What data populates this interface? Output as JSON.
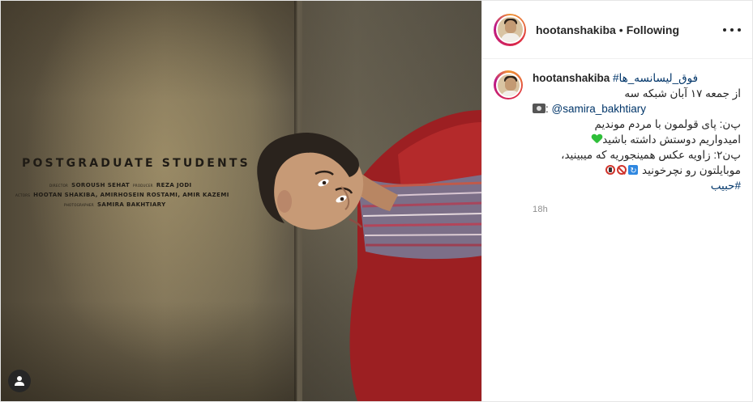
{
  "post": {
    "username": "hootanshakiba",
    "separator": "•",
    "follow_status": "Following",
    "time_ago": "18h"
  },
  "media": {
    "poster_title": "POSTGRADUATE STUDENTS",
    "credits": {
      "director_label": "DIRECTOR",
      "director": "SOROUSH SEHAT",
      "producer_label": "PRODUCER",
      "producer": "REZA JODI",
      "actors_label": "ACTORS",
      "actors": "HOOTAN SHAKIBA, AMIRHOSEIN ROSTAMI, AMIR KAZEMI",
      "photographer_label": "PHOTOGRAPHER",
      "photographer": "SAMIRA BAKHTIARY"
    }
  },
  "caption": {
    "hashtag_1": "#فوق_لیسانسه_ها",
    "line_2": "از جمعه ۱۷ آبان شبکه سه",
    "camera_mention": "@samira_bakhtiary",
    "camera_prefix": ":",
    "line_4": "پ‌ن: پای قولمون با مردم موندیم",
    "line_5": "امیدواریم دوستش داشته باشید",
    "line_6": "پ‌ن۲: زاویه عکس همینجوریه که میبینید،",
    "line_7": "موبایلتون رو نچرخونید",
    "hashtag_2": "#حبیب"
  },
  "icons": {
    "more": "more-options-icon",
    "tag": "user-tag-icon",
    "camera": "camera-emoji-icon"
  },
  "colors": {
    "link": "#003569",
    "muted": "#8e8e8e",
    "text": "#262626"
  }
}
